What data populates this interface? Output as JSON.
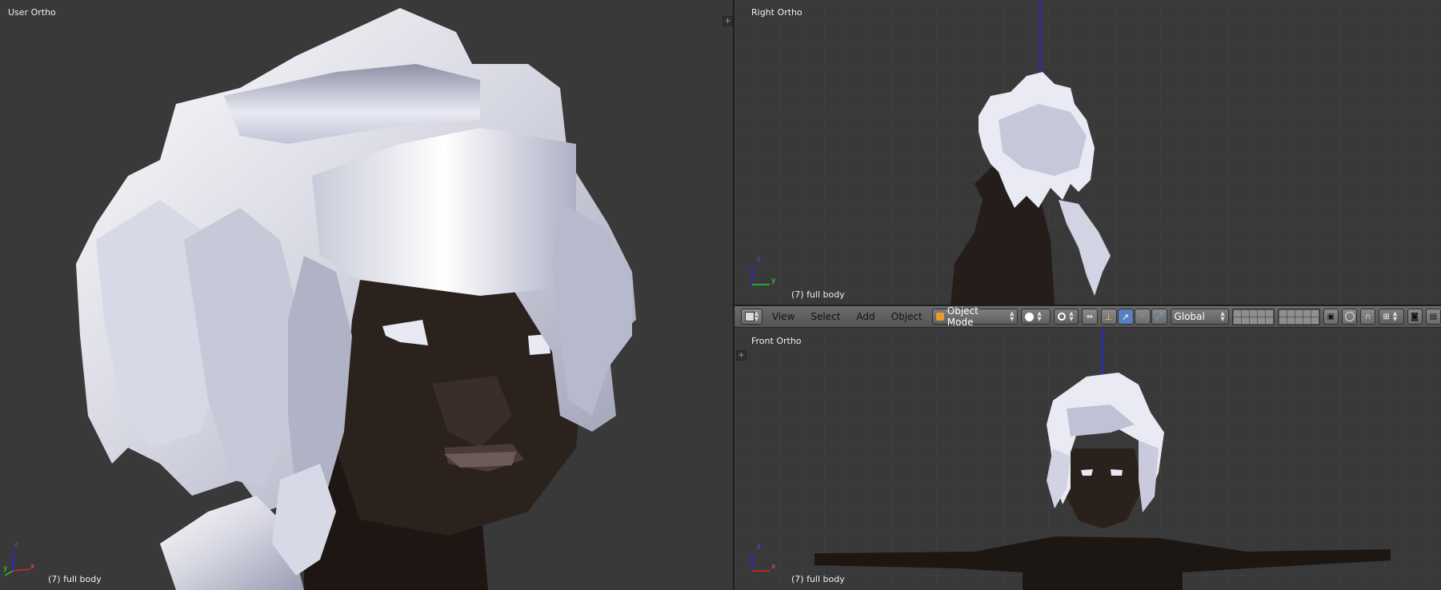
{
  "viewports": {
    "user": {
      "label": "User Ortho",
      "footer": "(7) full body"
    },
    "right": {
      "label": "Right Ortho",
      "footer": "(7) full body"
    },
    "front": {
      "label": "Front Ortho",
      "footer": "(7) full body"
    }
  },
  "axes": {
    "z": "z",
    "y": "y",
    "x": "x"
  },
  "header": {
    "menus": [
      "View",
      "Select",
      "Add",
      "Object"
    ],
    "mode": "Object Mode",
    "orientation": "Global",
    "corner_plus": "+"
  },
  "colors": {
    "background": "#393939",
    "hair": "#e6e8f2",
    "skin": "#2a211d",
    "header": "#606060",
    "axis_blue": "#2222ff",
    "axis_green": "#22cc22",
    "axis_red": "#dd2222"
  }
}
